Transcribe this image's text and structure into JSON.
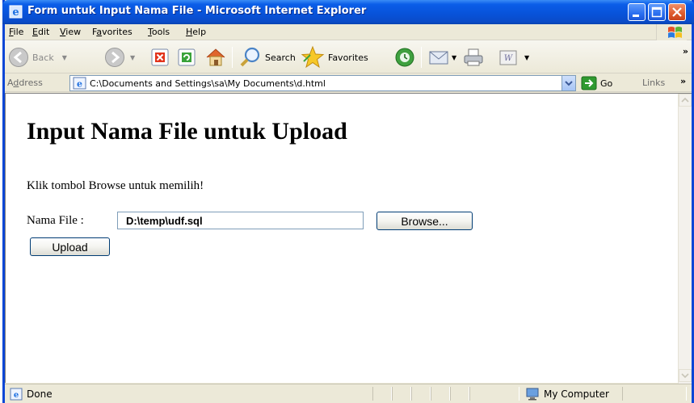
{
  "window": {
    "title": "Form untuk Input Nama File - Microsoft Internet Explorer"
  },
  "menu": {
    "items": [
      {
        "mnemonic": "F",
        "rest": "ile"
      },
      {
        "mnemonic": "E",
        "rest": "dit"
      },
      {
        "mnemonic": "V",
        "rest": "iew"
      },
      {
        "prefix": "F",
        "mnemonic": "a",
        "rest": "vorites"
      },
      {
        "mnemonic": "T",
        "rest": "ools"
      },
      {
        "mnemonic": "H",
        "rest": "elp"
      }
    ]
  },
  "toolbar": {
    "back_label": "Back",
    "search_label": "Search",
    "favorites_label": "Favorites"
  },
  "address": {
    "label": "Address",
    "label_mnemonic": "d",
    "url": "C:\\Documents and Settings\\sa\\My Documents\\d.html",
    "go_label": "Go",
    "links_label": "Links"
  },
  "page": {
    "heading": "Input Nama File untuk Upload",
    "instruction": "Klik tombol Browse untuk memilih!",
    "field_label": "Nama File :",
    "file_value": "D:\\temp\\udf.sql",
    "browse_label": "Browse...",
    "upload_label": "Upload"
  },
  "status": {
    "text": "Done",
    "zone": "My Computer"
  },
  "colors": {
    "titlebar": "#0a5de8",
    "chrome": "#ece9d8",
    "go_green": "#2f9a2f"
  },
  "icons": [
    "ie-icon",
    "minimize-icon",
    "maximize-icon",
    "close-icon",
    "windows-logo-icon",
    "back-arrow-icon",
    "forward-arrow-icon",
    "stop-icon",
    "refresh-icon",
    "home-icon",
    "search-icon",
    "favorites-star-icon",
    "history-icon",
    "mail-icon",
    "print-icon",
    "edit-icon",
    "page-icon",
    "go-arrow-icon",
    "computer-icon"
  ]
}
